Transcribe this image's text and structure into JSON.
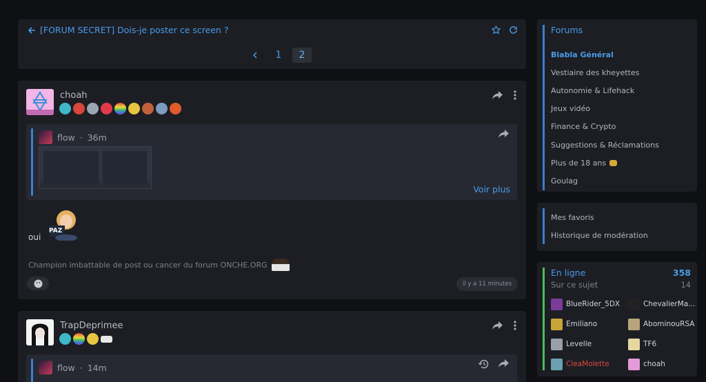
{
  "topic": {
    "title": "[FORUM SECRET] Dois-je poster ce screen ?",
    "pages": [
      "1",
      "2"
    ],
    "current_page": "2"
  },
  "posts": [
    {
      "username": "choah",
      "badge_colors": [
        "#3fb7c6",
        "#d9463c",
        "#9aa6b3",
        "#e33a4a",
        "#e8a23a",
        "#e6c640",
        "#c2603c",
        "#7c9cc0",
        "#e05b2a"
      ],
      "quote": {
        "author": "flow",
        "age": "36m",
        "more_label": "Voir plus"
      },
      "text": "oui",
      "sticker_text": "PAZ",
      "signature": "Champion imbattable de post ou cancer du forum ONCHE.ORG",
      "timestamp": "il y a 11 minutes"
    },
    {
      "username": "TrapDeprimee",
      "badge_colors": [
        "#3fb7c6",
        "#e8a23a",
        "#e6c640",
        "#e8e8e8"
      ],
      "quote": {
        "author": "flow",
        "age": "14m"
      }
    }
  ],
  "sidebar": {
    "forums_heading": "Forums",
    "forums": [
      "Blabla Général",
      "Vestiaire des kheyettes",
      "Autonomie & Lifehack",
      "Jeux vidéo",
      "Finance & Crypto",
      "Suggestions & Réclamations",
      "Plus de 18 ans",
      "Goulag"
    ],
    "current_forum": "Blabla Général",
    "links": [
      "Mes favoris",
      "Historique de modération"
    ],
    "online": {
      "label": "En ligne",
      "count": "358",
      "topic_label": "Sur ce sujet",
      "topic_count": "14",
      "users": [
        {
          "name": "BlueRider_5DX",
          "color": "#d0d3d9",
          "avatar": "#7a3b9a"
        },
        {
          "name": "ChevalierMa...",
          "color": "#d0d3d9",
          "avatar": "#222222"
        },
        {
          "name": "Emiliano",
          "color": "#d0d3d9",
          "avatar": "#c9a437"
        },
        {
          "name": "AbominouRSA",
          "color": "#d0d3d9",
          "avatar": "#b8a47a"
        },
        {
          "name": "Levelle",
          "color": "#d0d3d9",
          "avatar": "#9aa0aa"
        },
        {
          "name": "TF6",
          "color": "#d0d3d9",
          "avatar": "#e6d7a0"
        },
        {
          "name": "CleaMolette",
          "color": "#e0483e",
          "avatar": "#6aa0b0"
        },
        {
          "name": "choah",
          "color": "#d0d3d9",
          "avatar": "#e49ad6"
        }
      ]
    }
  },
  "colors": {
    "accent": "#4a9be8",
    "background": "#0f1013",
    "card": "#1c1e24",
    "danger": "#e0483e"
  }
}
